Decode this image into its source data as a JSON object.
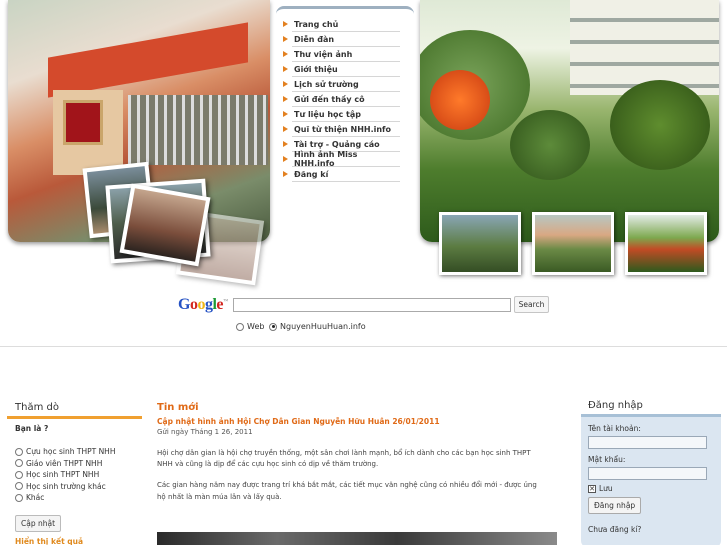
{
  "nav": {
    "items": [
      {
        "label": "Trang chủ"
      },
      {
        "label": "Diễn đàn"
      },
      {
        "label": "Thư viện ảnh"
      },
      {
        "label": "Giới thiệu"
      },
      {
        "label": "Lịch sử trường"
      },
      {
        "label": "Gửi đến thầy cô"
      },
      {
        "label": "Tư liệu học tập"
      },
      {
        "label": "Quĩ từ thiện NHH.info"
      },
      {
        "label": "Tài trợ - Quảng cáo"
      },
      {
        "label": "Hình ảnh Miss NHH.info"
      },
      {
        "label": "Đăng kí"
      }
    ]
  },
  "search": {
    "button_label": "Search",
    "options": [
      {
        "label": "Web",
        "selected": false
      },
      {
        "label": "NguyenHuuHuan.info",
        "selected": true
      }
    ]
  },
  "poll": {
    "title": "Thăm dò",
    "question": "Bạn là ?",
    "options": [
      "Cựu học sinh THPT NHH",
      "Giáo viên THPT NHH",
      "Học sinh THPT NHH",
      "Học sinh trường khác",
      "Khác"
    ],
    "vote_label": "Cập nhật",
    "results_label": "Hiển thị kết quả"
  },
  "news": {
    "section_title": "Tin mới",
    "headline": "Cập nhật hình ảnh Hội Chợ Dân Gian Nguyễn Hữu Huân 26/01/2011",
    "date": "Gửi ngày Tháng 1 26, 2011",
    "paragraphs": [
      "Hội chợ dân gian là hội chợ truyền thống, một sân chơi lành mạnh, bổ ích dành cho các bạn học sinh THPT NHH và cũng là dịp để các cựu học sinh có dịp về thăm trường.",
      "Các gian hàng năm nay được trang trí khá bắt mắt, các tiết mục văn nghệ cũng có nhiều đổi mới - được ủng hộ nhất là màn múa lân và lấy quà."
    ]
  },
  "login": {
    "title": "Đăng nhập",
    "username_label": "Tên tài khoản:",
    "password_label": "Mật khẩu:",
    "remember_label": "Lưu",
    "remember_checked": true,
    "button_label": "Đăng nhập",
    "register_prompt": "Chưa đăng kí?"
  },
  "colors": {
    "accent_orange": "#e06a17",
    "menu_arrow": "#e3801f",
    "login_bg": "#dbe6f1"
  }
}
